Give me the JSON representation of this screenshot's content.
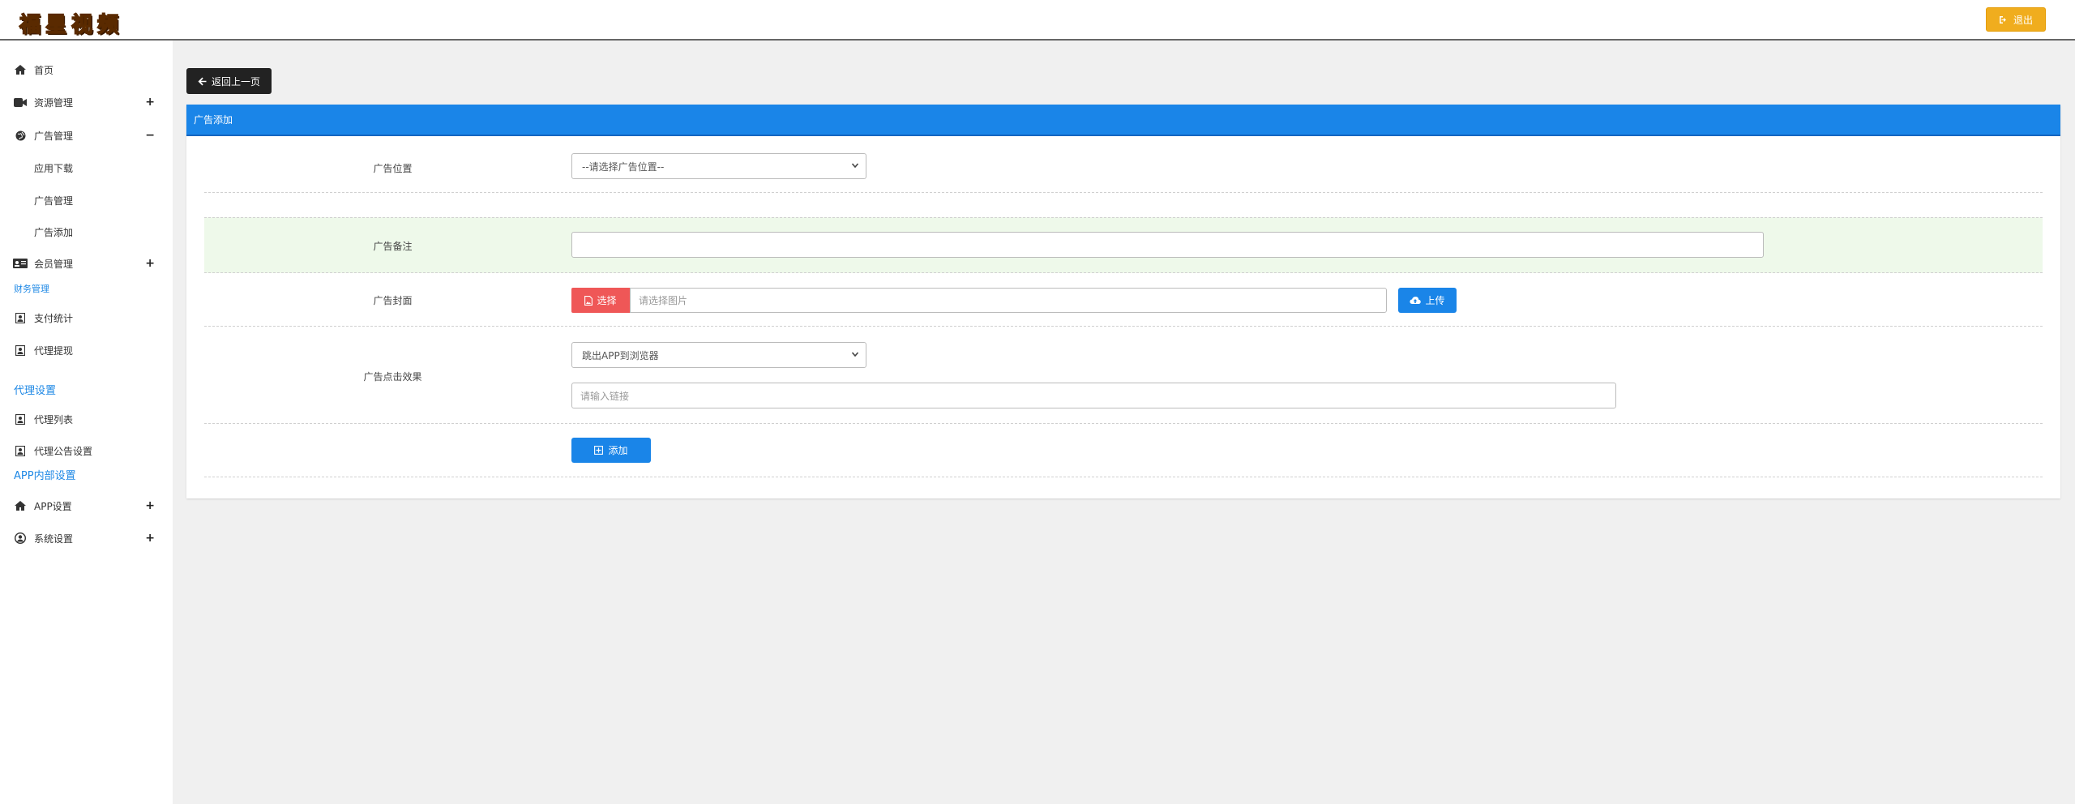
{
  "header": {
    "logo_text": "福星视频",
    "logout_label": "退出"
  },
  "sidebar": {
    "home": "首页",
    "resource": "资源管理",
    "ads": "广告管理",
    "ads_children": [
      "应用下载",
      "广告管理",
      "广告添加"
    ],
    "members": "会员管理",
    "finance_title": "财务管理",
    "pay_stats": "支付统计",
    "agent_withdraw": "代理提现",
    "agent_settings_title": "代理设置",
    "agent_list": "代理列表",
    "agent_notice": "代理公告设置",
    "app_internal_title": "APP内部设置",
    "app_settings": "APP设置",
    "system_settings": "系统设置",
    "plus_sign": "+",
    "minus_sign": "−"
  },
  "main": {
    "back_label": "返回上一页",
    "panel_title": "广告添加",
    "form": {
      "position_label": "广告位置",
      "position_value": "--请选择广告位置--",
      "remark_label": "广告备注",
      "remark_value": "",
      "cover_label": "广告封面",
      "choose_label": "选择",
      "cover_placeholder": "请选择图片",
      "upload_label": "上传",
      "click_label": "广告点击效果",
      "click_value": "跳出APP到浏览器",
      "link_placeholder": "请输入链接",
      "submit_label": "添加"
    }
  },
  "colors": {
    "accent": "#1a85e8",
    "logout": "#f0ad1e",
    "danger": "#ef5757",
    "section_blue": "#1e88e5",
    "green_row": "#eef9ea"
  }
}
